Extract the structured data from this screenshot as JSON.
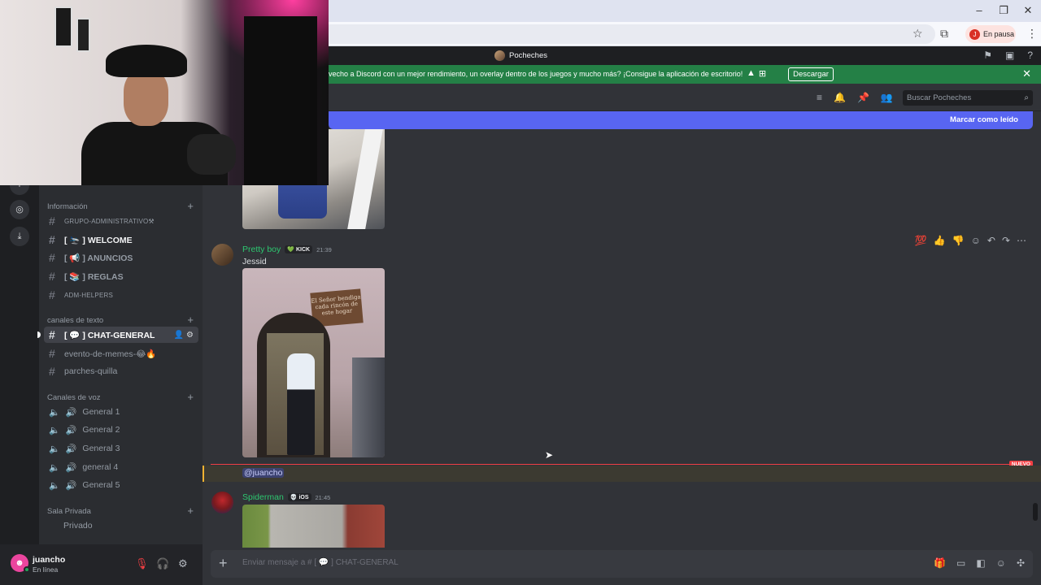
{
  "browser": {
    "pause_label": "En pausa",
    "pause_avatar": "J"
  },
  "titlebar": {
    "server_name": "Pocheches",
    "icons": [
      "flag-icon",
      "inbox-icon",
      "help-icon"
    ]
  },
  "notice": {
    "text": "vecho a Discord con un mejor rendimiento, un overlay dentro de los juegos y mucho más? ¡Consigue la aplicación de escritorio!",
    "download_label": "Descargar"
  },
  "header": {
    "search_placeholder": "Buscar Pocheches",
    "unread_label": "Marcar como leído"
  },
  "sidebar": {
    "categories": {
      "info": "Información",
      "text": "canales de texto",
      "voice": "Canales de voz",
      "private": "Sala Privada"
    },
    "info_channels": [
      {
        "label": "GRUPO-ADMINISTRATIVO⚒"
      },
      {
        "label": "[ 🛬 ] WELCOME"
      },
      {
        "label": "[ 📢 ] ANUNCIOS"
      },
      {
        "label": "[ 📚 ] REGLAS"
      },
      {
        "label": "ADM-HELPERS"
      }
    ],
    "text_channels": [
      {
        "label": "[ 💬 ] CHAT-GENERAL"
      },
      {
        "label": "evento-de-memes-😂🔥"
      },
      {
        "label": "parches-quilla"
      }
    ],
    "voice_channels": [
      {
        "label": "General 1"
      },
      {
        "label": "General 2"
      },
      {
        "label": "General 3"
      },
      {
        "label": "general 4"
      },
      {
        "label": "General 5"
      }
    ],
    "private_channels": [
      {
        "label": "Privado"
      }
    ]
  },
  "user": {
    "name": "juancho",
    "status": "En línea"
  },
  "messages": [
    {
      "author": "Pretty boy",
      "author_color": "#2dc770",
      "tag": "KICK",
      "time": "21:39",
      "text": "Jessid"
    },
    {
      "author": "Spiderman",
      "author_color": "#2dc770",
      "tag": "iOS",
      "time": "21:45"
    }
  ],
  "new_badge": "NUEVO",
  "mention": "@juancho",
  "photo_sign": "El Señor bendiga cada rincón de este hogar",
  "composer": {
    "placeholder": "Enviar mensaje a # [ 💬 ] CHAT-GENERAL"
  },
  "colors": {
    "blurple": "#5865f2",
    "green": "#248046",
    "online": "#23a55a",
    "new_red": "#f23f43"
  }
}
